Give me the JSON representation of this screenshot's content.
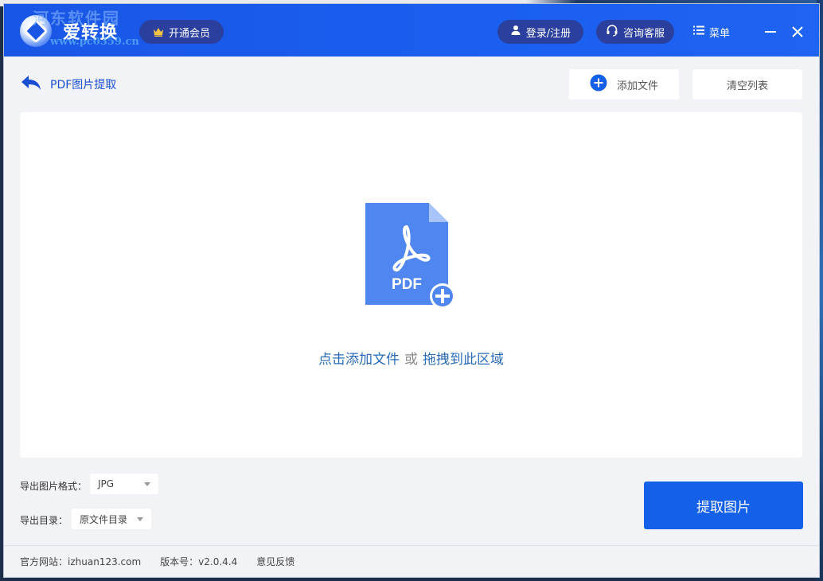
{
  "watermark": {
    "text": "河东软件园",
    "url": "www.pc0359.cn"
  },
  "titlebar": {
    "app_name": "爱转换",
    "vip_label": "开通会员",
    "login_label": "登录/注册",
    "service_label": "咨询客服",
    "menu_label": "菜单"
  },
  "toolbar": {
    "page_title": "PDF图片提取",
    "add_file_label": "添加文件",
    "clear_list_label": "清空列表"
  },
  "dropzone": {
    "pdf_icon_text": "PDF",
    "click_text": "点击添加文件",
    "or_text": "或",
    "drag_text": "拖拽到此区域"
  },
  "settings": {
    "format_label": "导出图片格式：",
    "format_value": "JPG",
    "dir_label": "导出目录：",
    "dir_value": "原文件目录"
  },
  "extract_button": "提取图片",
  "footer": {
    "website": "官方网站：izhuan123.com",
    "version": "版本号：v2.0.4.4",
    "feedback": "意见反馈"
  },
  "colors": {
    "titlebar": "#1a5ff0",
    "pill": "#2a3f9e",
    "accent": "#1560e8",
    "pdf_icon": "#4f86f0",
    "link": "#2a6bb8",
    "crown": "#f6c343"
  }
}
